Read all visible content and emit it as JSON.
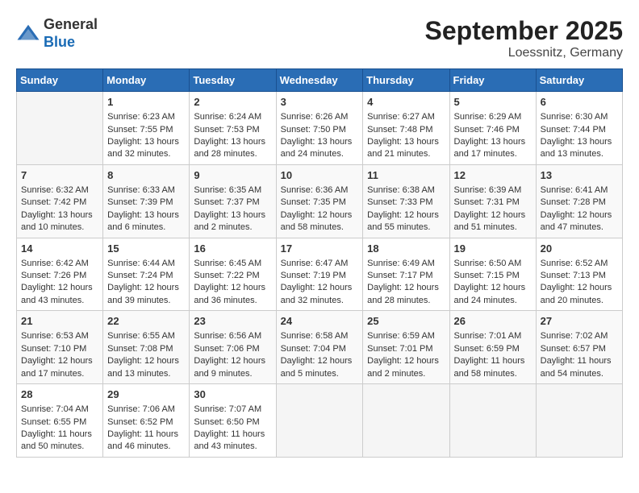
{
  "header": {
    "logo_general": "General",
    "logo_blue": "Blue",
    "month_title": "September 2025",
    "location": "Loessnitz, Germany"
  },
  "days_of_week": [
    "Sunday",
    "Monday",
    "Tuesday",
    "Wednesday",
    "Thursday",
    "Friday",
    "Saturday"
  ],
  "weeks": [
    [
      {
        "day": "",
        "empty": true
      },
      {
        "day": "1",
        "sunrise": "Sunrise: 6:23 AM",
        "sunset": "Sunset: 7:55 PM",
        "daylight": "Daylight: 13 hours and 32 minutes."
      },
      {
        "day": "2",
        "sunrise": "Sunrise: 6:24 AM",
        "sunset": "Sunset: 7:53 PM",
        "daylight": "Daylight: 13 hours and 28 minutes."
      },
      {
        "day": "3",
        "sunrise": "Sunrise: 6:26 AM",
        "sunset": "Sunset: 7:50 PM",
        "daylight": "Daylight: 13 hours and 24 minutes."
      },
      {
        "day": "4",
        "sunrise": "Sunrise: 6:27 AM",
        "sunset": "Sunset: 7:48 PM",
        "daylight": "Daylight: 13 hours and 21 minutes."
      },
      {
        "day": "5",
        "sunrise": "Sunrise: 6:29 AM",
        "sunset": "Sunset: 7:46 PM",
        "daylight": "Daylight: 13 hours and 17 minutes."
      },
      {
        "day": "6",
        "sunrise": "Sunrise: 6:30 AM",
        "sunset": "Sunset: 7:44 PM",
        "daylight": "Daylight: 13 hours and 13 minutes."
      }
    ],
    [
      {
        "day": "7",
        "sunrise": "Sunrise: 6:32 AM",
        "sunset": "Sunset: 7:42 PM",
        "daylight": "Daylight: 13 hours and 10 minutes."
      },
      {
        "day": "8",
        "sunrise": "Sunrise: 6:33 AM",
        "sunset": "Sunset: 7:39 PM",
        "daylight": "Daylight: 13 hours and 6 minutes."
      },
      {
        "day": "9",
        "sunrise": "Sunrise: 6:35 AM",
        "sunset": "Sunset: 7:37 PM",
        "daylight": "Daylight: 13 hours and 2 minutes."
      },
      {
        "day": "10",
        "sunrise": "Sunrise: 6:36 AM",
        "sunset": "Sunset: 7:35 PM",
        "daylight": "Daylight: 12 hours and 58 minutes."
      },
      {
        "day": "11",
        "sunrise": "Sunrise: 6:38 AM",
        "sunset": "Sunset: 7:33 PM",
        "daylight": "Daylight: 12 hours and 55 minutes."
      },
      {
        "day": "12",
        "sunrise": "Sunrise: 6:39 AM",
        "sunset": "Sunset: 7:31 PM",
        "daylight": "Daylight: 12 hours and 51 minutes."
      },
      {
        "day": "13",
        "sunrise": "Sunrise: 6:41 AM",
        "sunset": "Sunset: 7:28 PM",
        "daylight": "Daylight: 12 hours and 47 minutes."
      }
    ],
    [
      {
        "day": "14",
        "sunrise": "Sunrise: 6:42 AM",
        "sunset": "Sunset: 7:26 PM",
        "daylight": "Daylight: 12 hours and 43 minutes."
      },
      {
        "day": "15",
        "sunrise": "Sunrise: 6:44 AM",
        "sunset": "Sunset: 7:24 PM",
        "daylight": "Daylight: 12 hours and 39 minutes."
      },
      {
        "day": "16",
        "sunrise": "Sunrise: 6:45 AM",
        "sunset": "Sunset: 7:22 PM",
        "daylight": "Daylight: 12 hours and 36 minutes."
      },
      {
        "day": "17",
        "sunrise": "Sunrise: 6:47 AM",
        "sunset": "Sunset: 7:19 PM",
        "daylight": "Daylight: 12 hours and 32 minutes."
      },
      {
        "day": "18",
        "sunrise": "Sunrise: 6:49 AM",
        "sunset": "Sunset: 7:17 PM",
        "daylight": "Daylight: 12 hours and 28 minutes."
      },
      {
        "day": "19",
        "sunrise": "Sunrise: 6:50 AM",
        "sunset": "Sunset: 7:15 PM",
        "daylight": "Daylight: 12 hours and 24 minutes."
      },
      {
        "day": "20",
        "sunrise": "Sunrise: 6:52 AM",
        "sunset": "Sunset: 7:13 PM",
        "daylight": "Daylight: 12 hours and 20 minutes."
      }
    ],
    [
      {
        "day": "21",
        "sunrise": "Sunrise: 6:53 AM",
        "sunset": "Sunset: 7:10 PM",
        "daylight": "Daylight: 12 hours and 17 minutes."
      },
      {
        "day": "22",
        "sunrise": "Sunrise: 6:55 AM",
        "sunset": "Sunset: 7:08 PM",
        "daylight": "Daylight: 12 hours and 13 minutes."
      },
      {
        "day": "23",
        "sunrise": "Sunrise: 6:56 AM",
        "sunset": "Sunset: 7:06 PM",
        "daylight": "Daylight: 12 hours and 9 minutes."
      },
      {
        "day": "24",
        "sunrise": "Sunrise: 6:58 AM",
        "sunset": "Sunset: 7:04 PM",
        "daylight": "Daylight: 12 hours and 5 minutes."
      },
      {
        "day": "25",
        "sunrise": "Sunrise: 6:59 AM",
        "sunset": "Sunset: 7:01 PM",
        "daylight": "Daylight: 12 hours and 2 minutes."
      },
      {
        "day": "26",
        "sunrise": "Sunrise: 7:01 AM",
        "sunset": "Sunset: 6:59 PM",
        "daylight": "Daylight: 11 hours and 58 minutes."
      },
      {
        "day": "27",
        "sunrise": "Sunrise: 7:02 AM",
        "sunset": "Sunset: 6:57 PM",
        "daylight": "Daylight: 11 hours and 54 minutes."
      }
    ],
    [
      {
        "day": "28",
        "sunrise": "Sunrise: 7:04 AM",
        "sunset": "Sunset: 6:55 PM",
        "daylight": "Daylight: 11 hours and 50 minutes."
      },
      {
        "day": "29",
        "sunrise": "Sunrise: 7:06 AM",
        "sunset": "Sunset: 6:52 PM",
        "daylight": "Daylight: 11 hours and 46 minutes."
      },
      {
        "day": "30",
        "sunrise": "Sunrise: 7:07 AM",
        "sunset": "Sunset: 6:50 PM",
        "daylight": "Daylight: 11 hours and 43 minutes."
      },
      {
        "day": "",
        "empty": true
      },
      {
        "day": "",
        "empty": true
      },
      {
        "day": "",
        "empty": true
      },
      {
        "day": "",
        "empty": true
      }
    ]
  ]
}
